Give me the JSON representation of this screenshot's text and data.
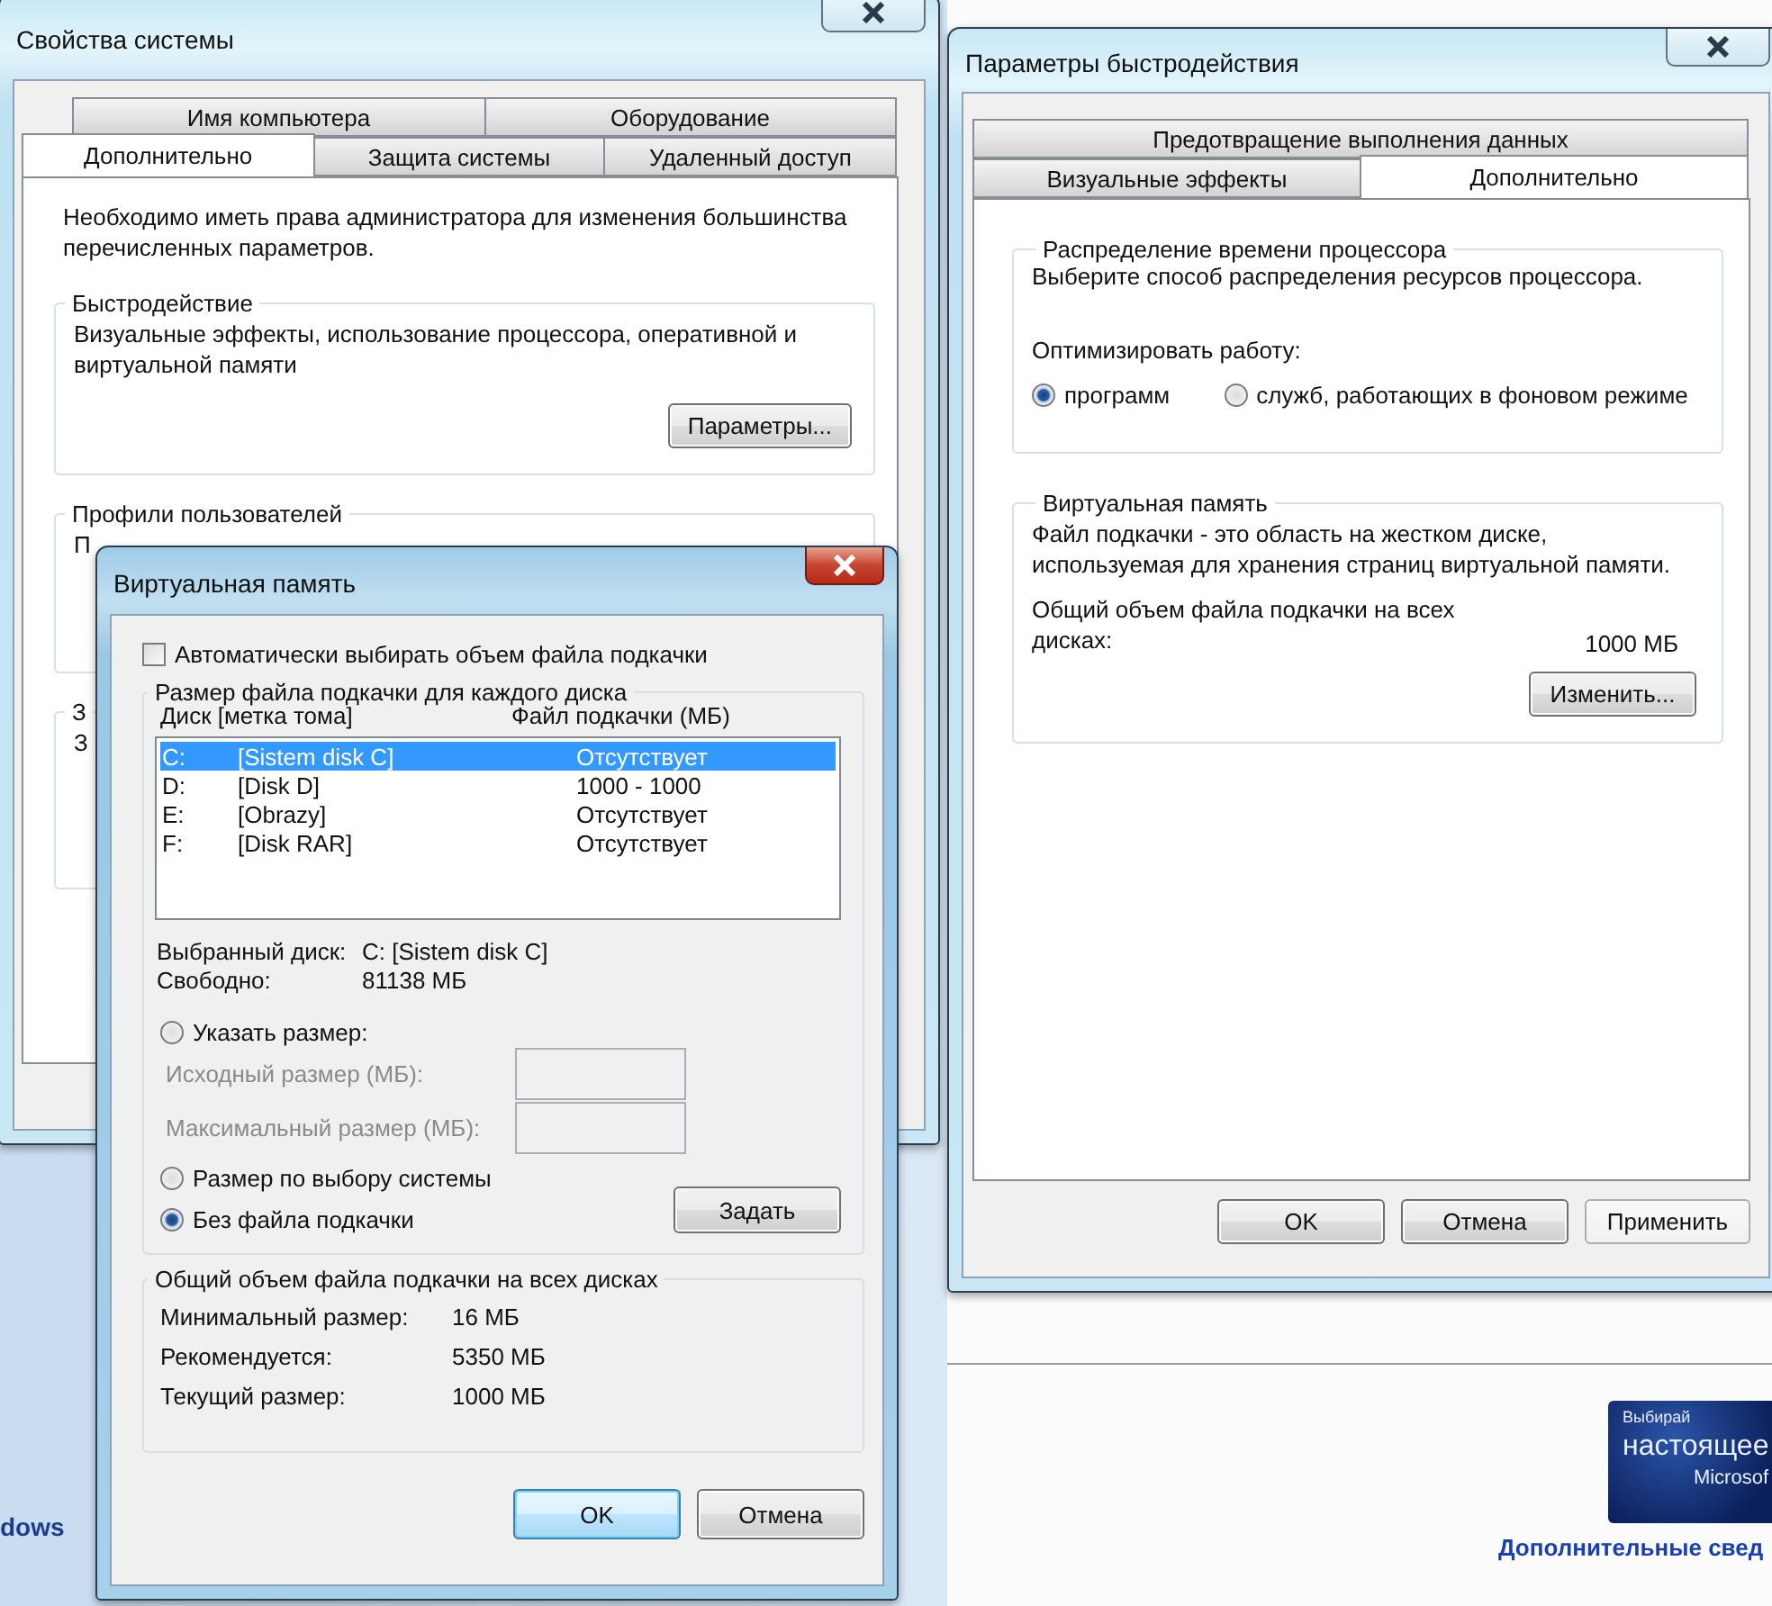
{
  "system_properties": {
    "title": "Свойства системы",
    "tab_rows": [
      {
        "tabs": [
          {
            "label": "Имя компьютера",
            "selected": false
          },
          {
            "label": "Оборудование",
            "selected": false
          }
        ]
      },
      {
        "tabs": [
          {
            "label": "Дополнительно",
            "selected": true
          },
          {
            "label": "Защита системы",
            "selected": false
          },
          {
            "label": "Удаленный доступ",
            "selected": false
          }
        ]
      }
    ],
    "notice": "Необходимо иметь права администратора для изменения большинства перечисленных параметров.",
    "groups": [
      {
        "legend": "Быстродействие",
        "text": "Визуальные эффекты, использование процессора, оперативной и виртуальной памяти",
        "button": "Параметры..."
      },
      {
        "legend": "Профили пользователей",
        "text": "П"
      },
      {
        "legend": "З",
        "text": "З"
      }
    ]
  },
  "performance_options": {
    "title": "Параметры быстродействия",
    "tab_rows": [
      {
        "tabs": [
          {
            "label": "Предотвращение выполнения данных",
            "selected": false
          }
        ]
      },
      {
        "tabs": [
          {
            "label": "Визуальные эффекты",
            "selected": false
          },
          {
            "label": "Дополнительно",
            "selected": true
          }
        ]
      }
    ],
    "processor_group": {
      "legend": "Распределение времени процессора",
      "text": "Выберите способ распределения ресурсов процессора.",
      "optimize_label": "Оптимизировать работу:",
      "options": [
        {
          "label": "программ",
          "selected": true
        },
        {
          "label": "служб, работающих в фоновом режиме",
          "selected": false
        }
      ]
    },
    "memory_group": {
      "legend": "Виртуальная память",
      "text": "Файл подкачки - это область на жестком диске, используемая для хранения страниц виртуальной памяти.",
      "total_label": "Общий объем файла подкачки на всех дисках:",
      "total_value": "1000 МБ",
      "button": "Изменить..."
    },
    "buttons": [
      {
        "label": "OK",
        "kind": "normal"
      },
      {
        "label": "Отмена",
        "kind": "normal"
      },
      {
        "label": "Применить",
        "kind": "flat"
      }
    ]
  },
  "virtual_memory": {
    "title": "Виртуальная память",
    "auto_checkbox": {
      "label": "Автоматически выбирать объем файла подкачки",
      "checked": false
    },
    "drives_legend": "Размер файла подкачки для каждого диска",
    "columns": [
      "Диск [метка тома]",
      "Файл подкачки (МБ)"
    ],
    "drives": [
      {
        "letter": "C:",
        "label": "[Sistem disk C]",
        "paging": "Отсутствует",
        "selected": true
      },
      {
        "letter": "D:",
        "label": "[Disk D]",
        "paging": "1000 - 1000",
        "selected": false
      },
      {
        "letter": "E:",
        "label": "[Obrazy]",
        "paging": "Отсутствует",
        "selected": false
      },
      {
        "letter": "F:",
        "label": "[Disk RAR]",
        "paging": "Отсутствует",
        "selected": false
      }
    ],
    "selected_drive": {
      "label": "Выбранный диск:",
      "value": "C:  [Sistem disk C]"
    },
    "free_space": {
      "label": "Свободно:",
      "value": "81138 МБ"
    },
    "size_options": [
      {
        "label": "Указать размер:",
        "selected": false
      },
      {
        "label": "Размер по выбору системы",
        "selected": false
      },
      {
        "label": "Без файла подкачки",
        "selected": true
      }
    ],
    "size_fields": [
      {
        "label": "Исходный размер (МБ):",
        "disabled": true
      },
      {
        "label": "Максимальный размер (МБ):",
        "disabled": true
      }
    ],
    "set_button": "Задать",
    "totals_legend": "Общий объем файла подкачки на всех дисках",
    "totals": [
      {
        "label": "Минимальный размер:",
        "value": "16 МБ"
      },
      {
        "label": "Рекомендуется:",
        "value": "5350 МБ"
      },
      {
        "label": "Текущий размер:",
        "value": "1000 МБ"
      }
    ],
    "buttons": [
      {
        "label": "OK",
        "kind": "default"
      },
      {
        "label": "Отмена",
        "kind": "normal"
      }
    ]
  },
  "desktop": {
    "side_text": "dows",
    "badge_lines": [
      "Выбирай",
      "настоящее",
      "Microsof"
    ],
    "link": "Дополнительные свед"
  }
}
